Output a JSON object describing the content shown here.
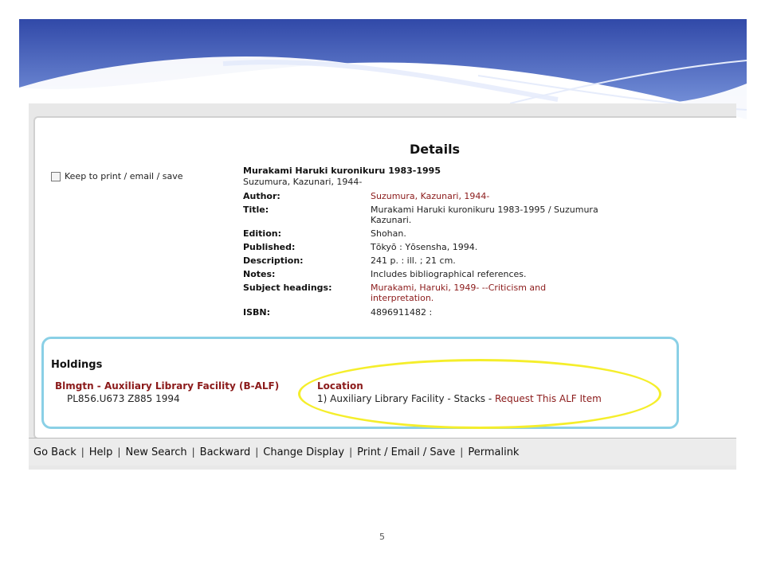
{
  "panel": {
    "title": "Details",
    "keep_label": "Keep to print / email / save",
    "record": {
      "title": "Murakami Haruki kuronikuru 1983-1995",
      "subtitle": "Suzumura, Kazunari, 1944-"
    },
    "fields": [
      {
        "label": "Author:",
        "value": "Suzumura, Kazunari, 1944-"
      },
      {
        "label": "Title:",
        "value": "Murakami Haruki kuronikuru 1983-1995 / Suzumura Kazunari."
      },
      {
        "label": "Edition:",
        "value": "Shohan."
      },
      {
        "label": "Published:",
        "value": "Tōkyō : Yōsensha, 1994."
      },
      {
        "label": "Description:",
        "value": "241 p. : ill. ; 21 cm."
      },
      {
        "label": "Notes:",
        "value": "Includes bibliographical references."
      },
      {
        "label": "Subject headings:",
        "value": "Murakami, Haruki, 1949- --Criticism and interpretation."
      },
      {
        "label": "ISBN:",
        "value": "4896911482 :"
      }
    ]
  },
  "holdings": {
    "title": "Holdings",
    "library": "Blmgtn - Auxiliary Library Facility (B-ALF)",
    "call_number": "PL856.U673 Z885 1994",
    "location_header": "Location",
    "location_text": "1) Auxiliary Library Facility - Stacks - ",
    "request_link": "Request This ALF Item"
  },
  "nav": [
    "Go Back",
    "Help",
    "New Search",
    "Backward",
    "Change Display",
    "Print / Email / Save",
    "Permalink"
  ],
  "nav_separator": "|",
  "page_number": "5",
  "colors": {
    "link": "#8b1a1a",
    "highlight_ellipse": "#f5ee2b",
    "holdings_border": "#8ad0e6",
    "banner": "#3a5bb5"
  }
}
